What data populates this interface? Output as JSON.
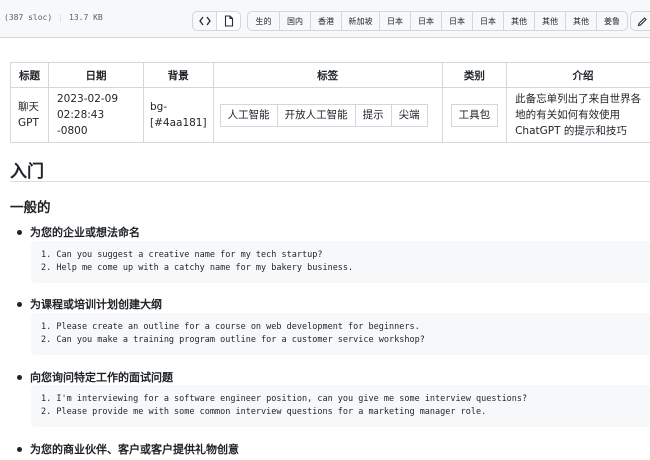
{
  "toolbar": {
    "sloc": "(387 sloc)",
    "size": "13.7 KB",
    "code_icon": "code-icon",
    "raw_icon": "file-icon",
    "edit_icon": "pencil-icon",
    "tabs": [
      "生的",
      "国内",
      "香港",
      "新加坡",
      "日本",
      "日本",
      "日本",
      "日本",
      "其他",
      "其他",
      "其他",
      "姜鲁"
    ]
  },
  "table": {
    "headers": [
      "标题",
      "日期",
      "背景",
      "标签",
      "类别",
      "介绍"
    ],
    "row": {
      "title": "聊天GPT",
      "date": "2023-02-09 02:28:43 -0800",
      "background": "bg-[#4aa181]",
      "tags": [
        "人工智能",
        "开放人工智能",
        "提示",
        "尖端"
      ],
      "category": "工具包",
      "intro": "此备忘单列出了来自世界各地的有关如何有效使用 ChatGPT 的提示和技巧"
    }
  },
  "content": {
    "h1": "入门",
    "h2": "一般的",
    "sections": [
      {
        "title": "为您的企业或想法命名",
        "lines": [
          "1. Can you suggest a creative name for my tech startup?",
          "2. Help me come up with a catchy name for my bakery business."
        ]
      },
      {
        "title": "为课程或培训计划创建大纲",
        "lines": [
          "1. Please create an outline for a course on web development for beginners.",
          "2. Can you make a training program outline for a customer service workshop?"
        ]
      },
      {
        "title": "向您询问特定工作的面试问题",
        "lines": [
          "1. I'm interviewing for a software engineer position, can you give me some interview questions?",
          "2. Please provide me with some common interview questions for a marketing manager role."
        ]
      },
      {
        "title": "为您的商业伙伴、客户或客户提供礼物创意",
        "lines": []
      }
    ]
  }
}
